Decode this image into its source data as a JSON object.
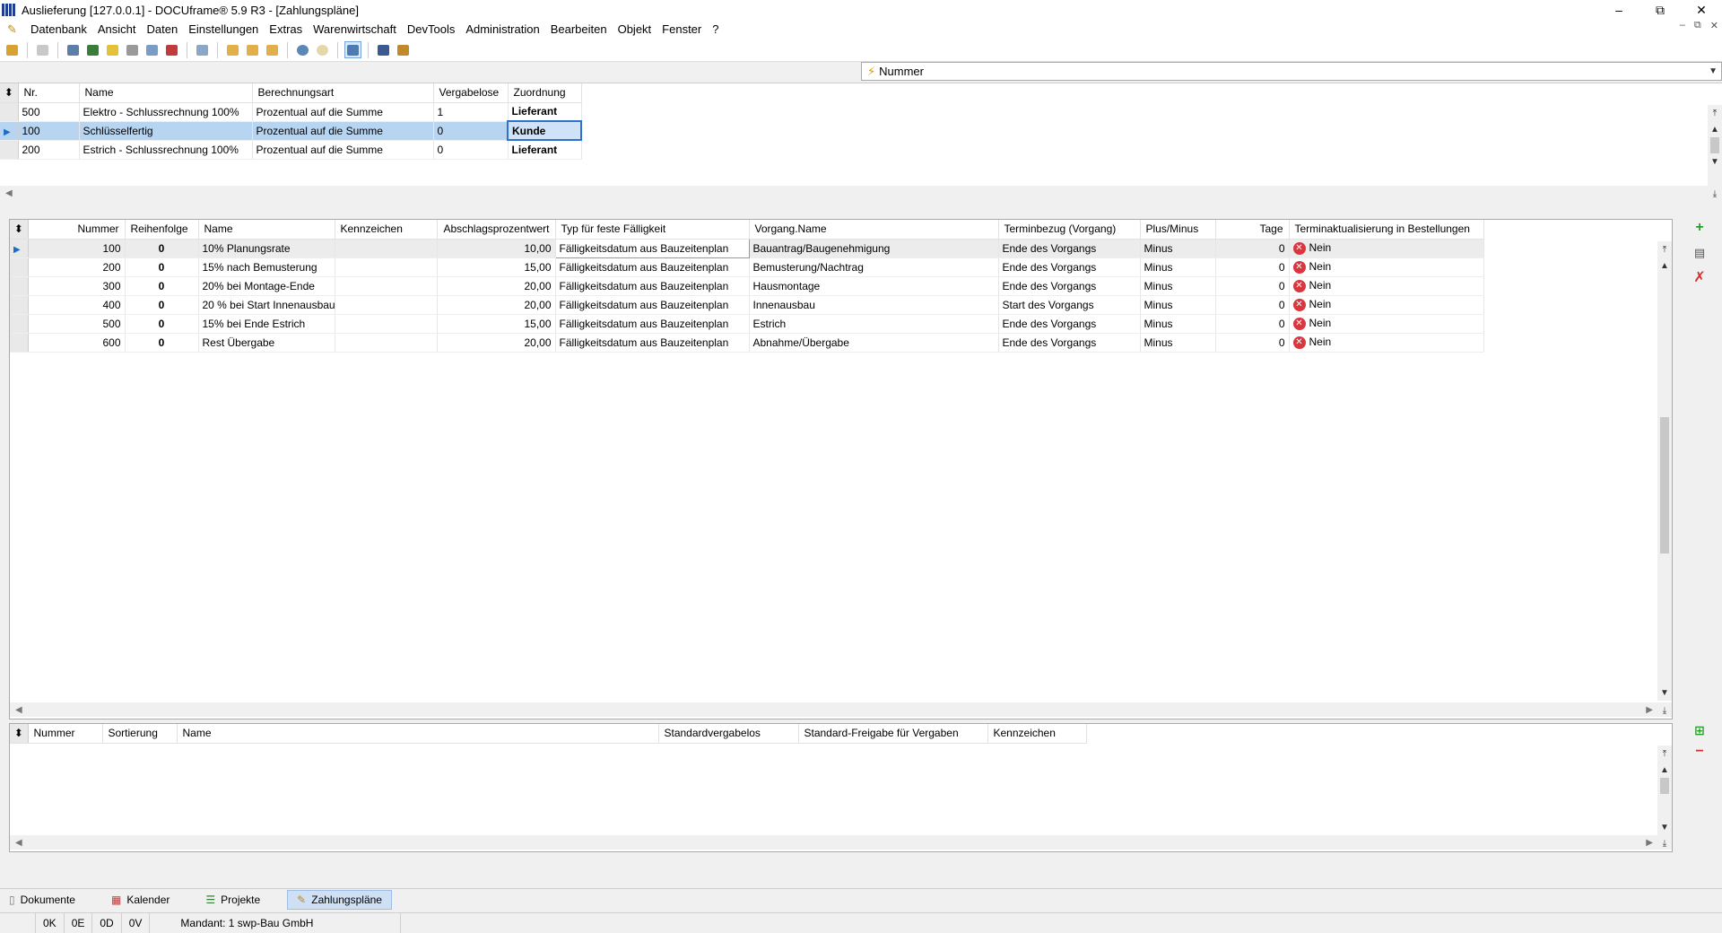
{
  "window": {
    "title": "Auslieferung [127.0.0.1] - DOCUframe® 5.9 R3 - [Zahlungspläne]",
    "minimize": "–",
    "maximize": "⧉",
    "close": "✕"
  },
  "menu": {
    "items": [
      "Datenbank",
      "Ansicht",
      "Daten",
      "Einstellungen",
      "Extras",
      "Warenwirtschaft",
      "DevTools",
      "Administration",
      "Bearbeiten",
      "Objekt",
      "Fenster",
      "?"
    ]
  },
  "search": {
    "field": "Nummer"
  },
  "top_table": {
    "columns": [
      "Nr.",
      "Name",
      "Berechnungsart",
      "Vergabelose",
      "Zuordnung"
    ],
    "rows": [
      [
        "500",
        "Elektro - Schlussrechnung 100%",
        "Prozentual auf die Summe",
        "1",
        "Lieferant"
      ],
      [
        "100",
        "Schlüsselfertig",
        "Prozentual auf die Summe",
        "0",
        "Kunde"
      ],
      [
        "200",
        "Estrich - Schlussrechnung 100%",
        "Prozentual auf die Summe",
        "0",
        "Lieferant"
      ]
    ]
  },
  "mid_table": {
    "columns": [
      "Nummer",
      "Reihenfolge",
      "Name",
      "Kennzeichen",
      "Abschlagsprozentwert",
      "Typ für feste Fälligkeit",
      "Vorgang.Name",
      "Terminbezug (Vorgang)",
      "Plus/Minus",
      "Tage",
      "Terminaktualisierung in Bestellungen"
    ],
    "rows": [
      [
        "100",
        "0",
        "10% Planungsrate",
        "",
        "10,00",
        "Fälligkeitsdatum aus Bauzeitenplan",
        "Bauantrag/Baugenehmigung",
        "Ende des Vorgangs",
        "Minus",
        "0",
        "Nein"
      ],
      [
        "200",
        "0",
        "15% nach Bemusterung",
        "",
        "15,00",
        "Fälligkeitsdatum aus Bauzeitenplan",
        "Bemusterung/Nachtrag",
        "Ende des Vorgangs",
        "Minus",
        "0",
        "Nein"
      ],
      [
        "300",
        "0",
        "20% bei Montage-Ende",
        "",
        "20,00",
        "Fälligkeitsdatum aus Bauzeitenplan",
        "Hausmontage",
        "Ende des Vorgangs",
        "Minus",
        "0",
        "Nein"
      ],
      [
        "400",
        "0",
        "20 % bei Start Innenausbau",
        "",
        "20,00",
        "Fälligkeitsdatum aus Bauzeitenplan",
        "Innenausbau",
        "Start des Vorgangs",
        "Minus",
        "0",
        "Nein"
      ],
      [
        "500",
        "0",
        "15% bei Ende Estrich",
        "",
        "15,00",
        "Fälligkeitsdatum aus Bauzeitenplan",
        "Estrich",
        "Ende des Vorgangs",
        "Minus",
        "0",
        "Nein"
      ],
      [
        "600",
        "0",
        "Rest Übergabe",
        "",
        "20,00",
        "Fälligkeitsdatum aus Bauzeitenplan",
        "Abnahme/Übergabe",
        "Ende des Vorgangs",
        "Minus",
        "0",
        "Nein"
      ]
    ]
  },
  "bottom_table": {
    "columns": [
      "Nummer",
      "Sortierung",
      "Name",
      "Standardvergabelos",
      "Standard-Freigabe für Vergaben",
      "Kennzeichen"
    ]
  },
  "tabs": [
    "Dokumente",
    "Kalender",
    "Projekte",
    "Zahlungspläne"
  ],
  "status": {
    "k": "0K",
    "e": "0E",
    "d": "0D",
    "v": "0V",
    "mandant": "Mandant: 1 swp-Bau GmbH"
  },
  "colors": {
    "selection": "#b7d4f0",
    "focus_border": "#2f72c7",
    "no_icon": "#d9363e",
    "add_green": "#2a9d2a",
    "delete_red": "#d32f2f"
  }
}
